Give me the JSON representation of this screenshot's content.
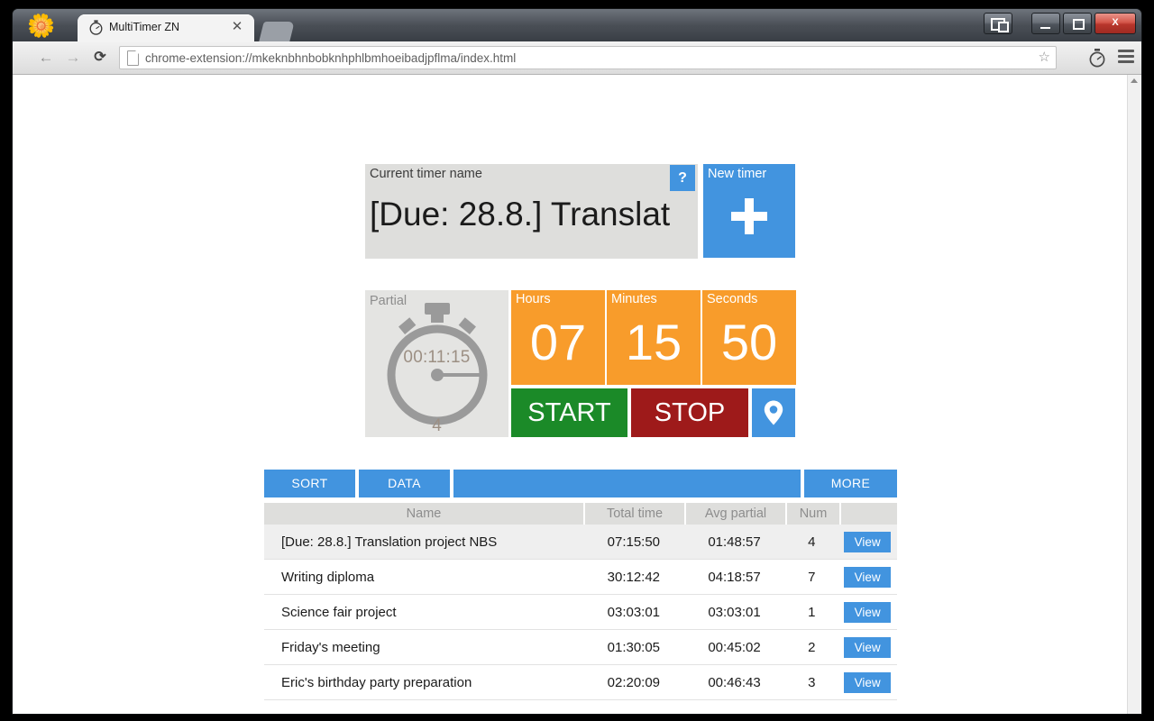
{
  "browser": {
    "tab": {
      "title": "MultiTimer ZN",
      "favicon_icon": "stopwatch-icon",
      "close_icon": "close-icon"
    },
    "url": "chrome-extension://mkeknbhnbobknhphlbmhoeibadjpflma/index.html",
    "nav": {
      "back_icon": "back-arrow-icon",
      "forward_icon": "forward-arrow-icon",
      "reload_icon": "reload-icon"
    },
    "omnibox": {
      "page_icon": "page-icon",
      "star_icon": "star-icon"
    },
    "extension_icon": "stopwatch-extension-icon",
    "menu_icon": "hamburger-menu-icon",
    "window_controls": {
      "restore_tab_icon": "tab-restore-icon",
      "minimize_icon": "minimize-icon",
      "maximize_icon": "maximize-icon",
      "close_icon": "close-window-icon",
      "close_glyph": "X"
    }
  },
  "app": {
    "name_panel": {
      "label": "Current timer name",
      "value": "[Due: 28.8.] Translat",
      "help_label": "?"
    },
    "new_timer": {
      "label": "New timer",
      "plus_icon": "plus-icon"
    },
    "partial": {
      "label": "Partial",
      "time": "00:11:15",
      "count": "4",
      "icon": "stopwatch-icon"
    },
    "clock": {
      "hours": {
        "label": "Hours",
        "value": "07"
      },
      "minutes": {
        "label": "Minutes",
        "value": "15"
      },
      "seconds": {
        "label": "Seconds",
        "value": "50"
      }
    },
    "actions": {
      "start": "START",
      "stop": "STOP",
      "location_icon": "location-pin-icon"
    },
    "toolbar": {
      "sort": "SORT",
      "data": "DATA",
      "more": "MORE"
    },
    "table": {
      "headers": {
        "name": "Name",
        "total": "Total time",
        "avg": "Avg partial",
        "num": "Num",
        "view": ""
      },
      "view_label": "View",
      "rows": [
        {
          "name": "[Due: 28.8.] Translation project NBS",
          "total": "07:15:50",
          "avg": "01:48:57",
          "num": "4",
          "action": "View"
        },
        {
          "name": "Writing diploma",
          "total": "30:12:42",
          "avg": "04:18:57",
          "num": "7",
          "action": "View"
        },
        {
          "name": "Science fair project",
          "total": "03:03:01",
          "avg": "03:03:01",
          "num": "1",
          "action": "View"
        },
        {
          "name": "Friday's meeting",
          "total": "01:30:05",
          "avg": "00:45:02",
          "num": "2",
          "action": "View"
        },
        {
          "name": "Eric's birthday party preparation",
          "total": "02:20:09",
          "avg": "00:46:43",
          "num": "3",
          "action": "View"
        }
      ]
    }
  },
  "colors": {
    "accent_blue": "#4294df",
    "orange": "#f89c2b",
    "green": "#1b8a28",
    "red": "#9e1a1a",
    "panel_gray": "#dededc",
    "row_highlight": "#efefef"
  }
}
